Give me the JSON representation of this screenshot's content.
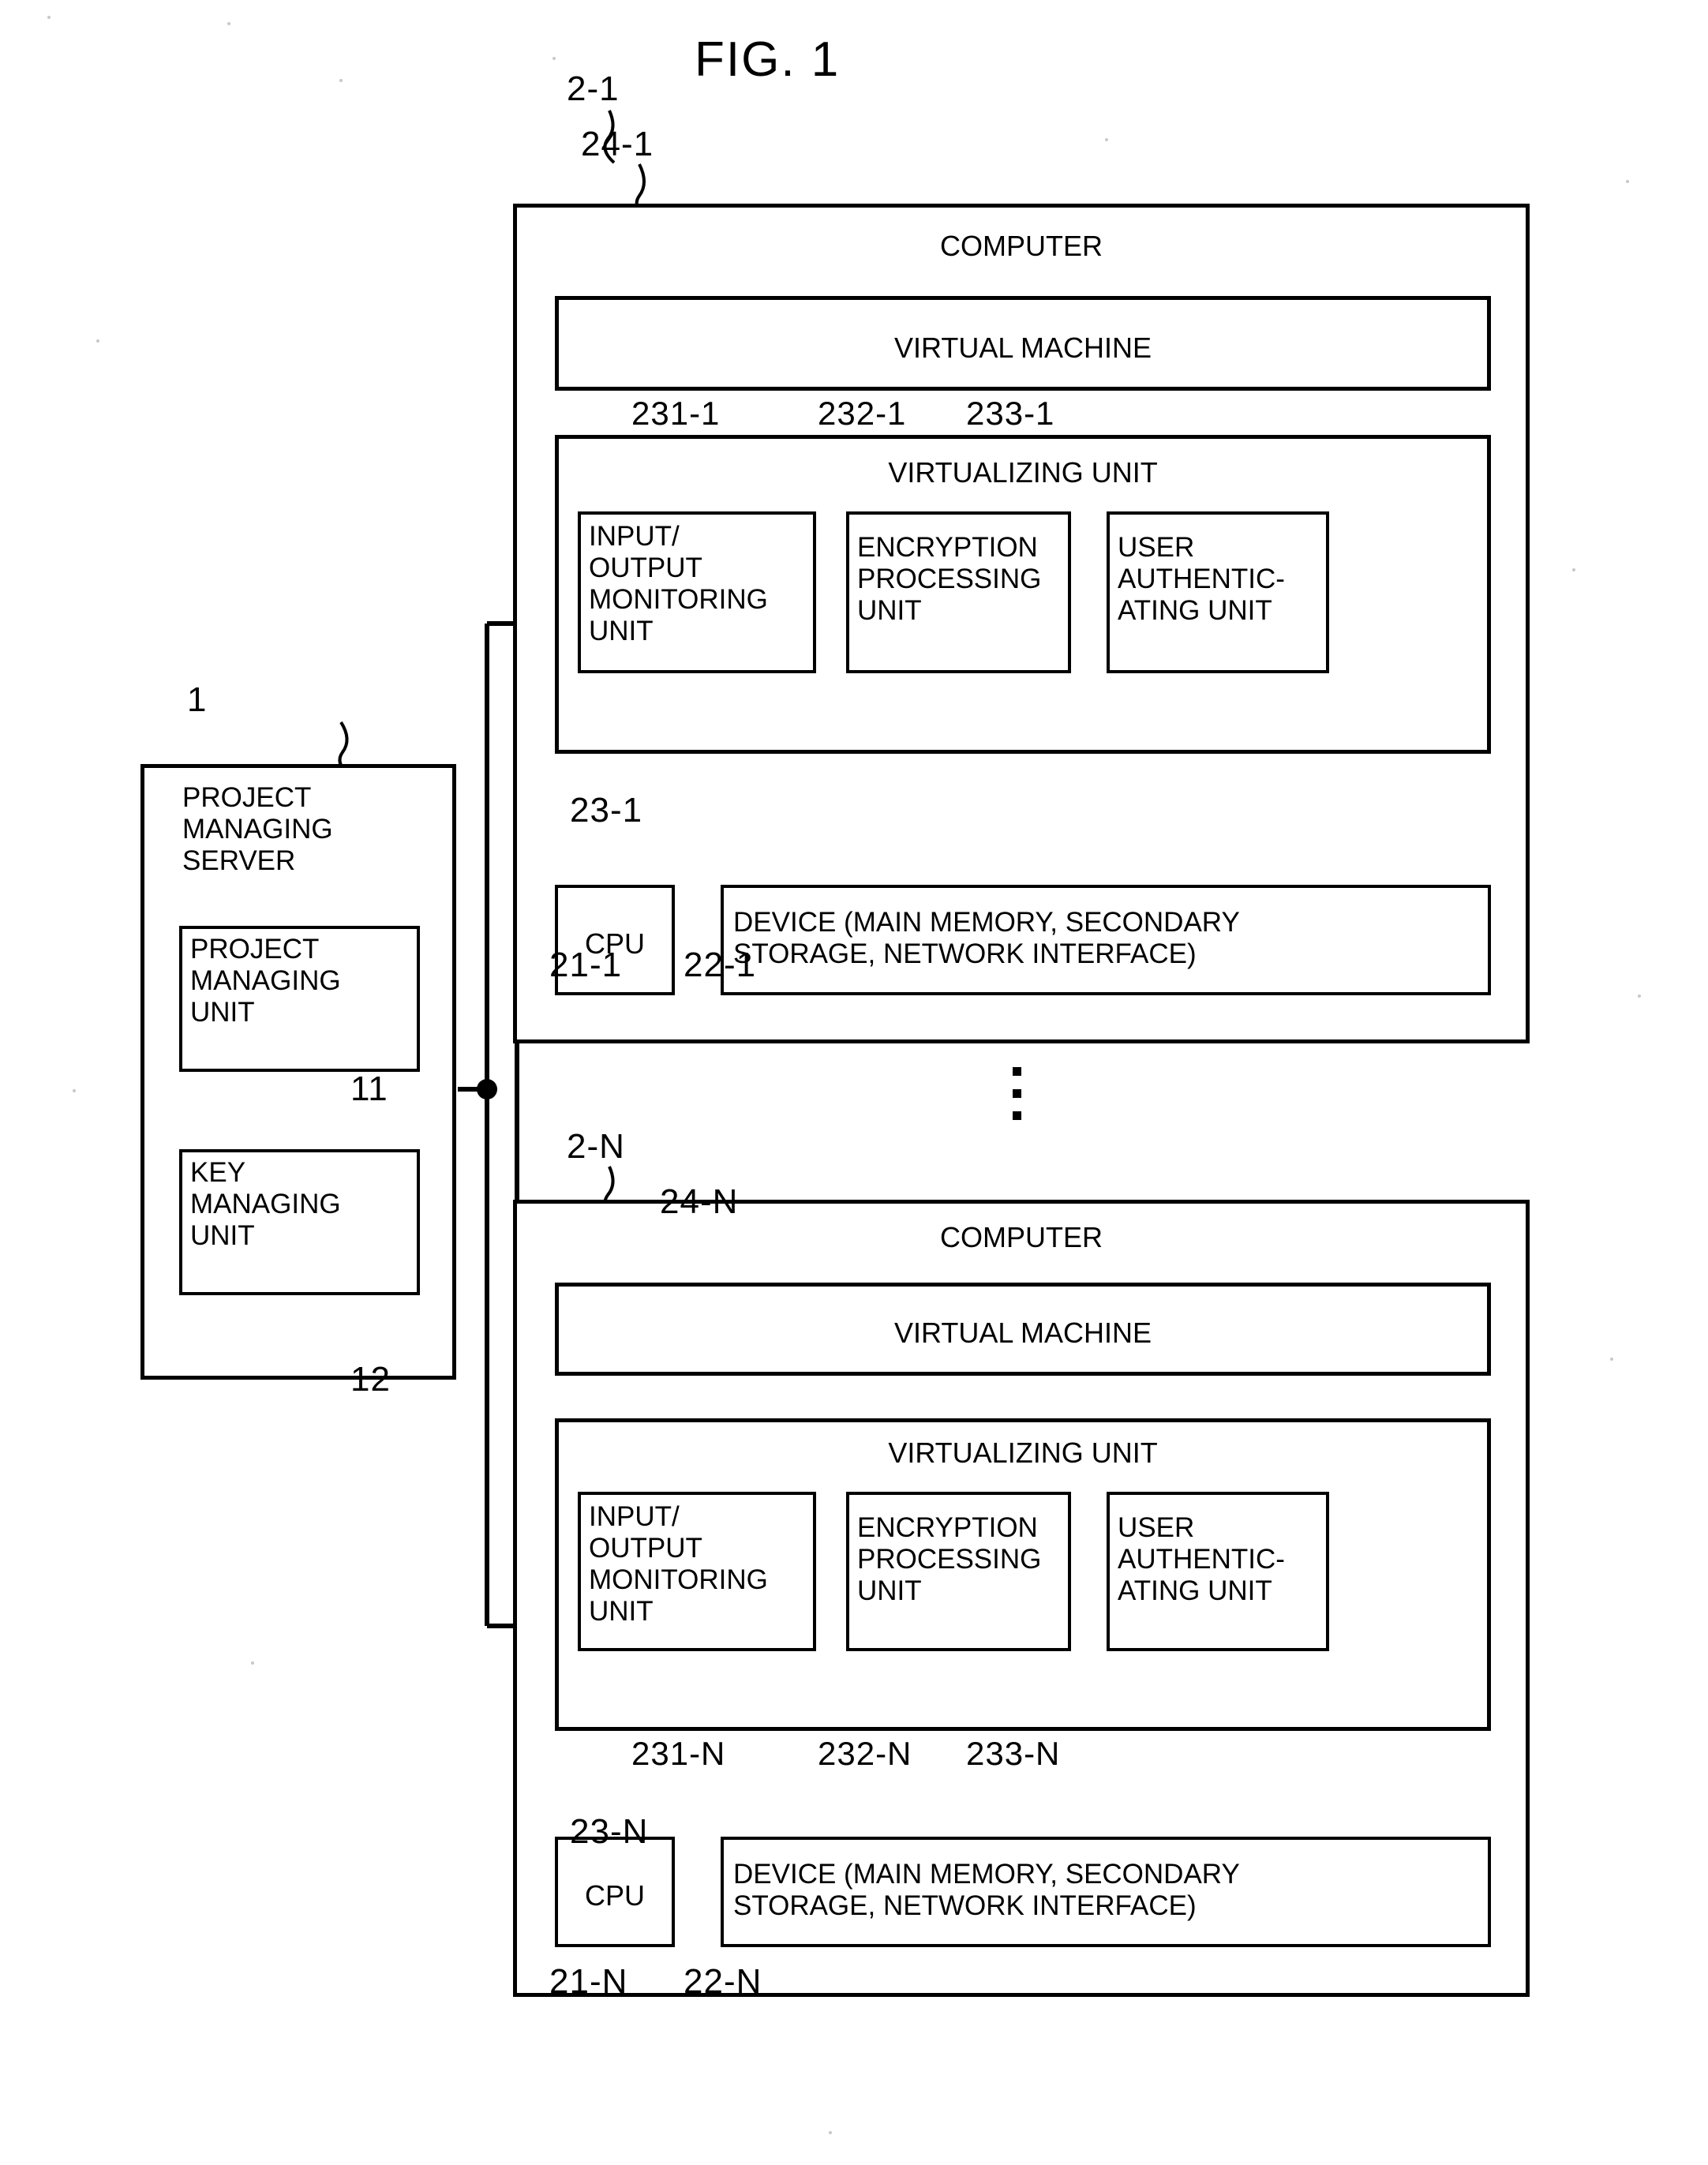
{
  "figure": {
    "title": "FIG. 1"
  },
  "server": {
    "ref": "1",
    "title": "PROJECT\nMANAGING\nSERVER",
    "units": [
      {
        "label": "PROJECT\nMANAGING\nUNIT",
        "ref": "11"
      },
      {
        "label": "KEY\nMANAGING\nUNIT",
        "ref": "12"
      }
    ]
  },
  "computers": [
    {
      "ref": "2-1",
      "title": "COMPUTER",
      "virtual_machine": {
        "label": "VIRTUAL MACHINE",
        "ref": "24-1"
      },
      "virtualizing_unit": {
        "label": "VIRTUALIZING UNIT",
        "ref": "23-1",
        "modules": [
          {
            "label": "INPUT/\nOUTPUT\nMONITORING\nUNIT",
            "ref": "231-1"
          },
          {
            "label": "ENCRYPTION\nPROCESSING\nUNIT",
            "ref": "232-1"
          },
          {
            "label": "USER\nAUTHENTIC-\nATING UNIT",
            "ref": "233-1"
          }
        ]
      },
      "cpu": {
        "label": "CPU",
        "ref": "21-1"
      },
      "device": {
        "label": "DEVICE (MAIN MEMORY, SECONDARY\nSTORAGE, NETWORK INTERFACE)",
        "ref": "22-1"
      }
    },
    {
      "ref": "2-N",
      "title": "COMPUTER",
      "virtual_machine": {
        "label": "VIRTUAL MACHINE",
        "ref": "24-N"
      },
      "virtualizing_unit": {
        "label": "VIRTUALIZING UNIT",
        "ref": "23-N",
        "modules": [
          {
            "label": "INPUT/\nOUTPUT\nMONITORING\nUNIT",
            "ref": "231-N"
          },
          {
            "label": "ENCRYPTION\nPROCESSING\nUNIT",
            "ref": "232-N"
          },
          {
            "label": "USER\nAUTHENTIC-\nATING UNIT",
            "ref": "233-N"
          }
        ]
      },
      "cpu": {
        "label": "CPU",
        "ref": "21-N"
      },
      "device": {
        "label": "DEVICE (MAIN MEMORY, SECONDARY\nSTORAGE, NETWORK INTERFACE)",
        "ref": "22-N"
      }
    }
  ],
  "ellipsis": "vertical-ellipsis",
  "colors": {
    "ink": "#000000",
    "paper": "#ffffff"
  }
}
